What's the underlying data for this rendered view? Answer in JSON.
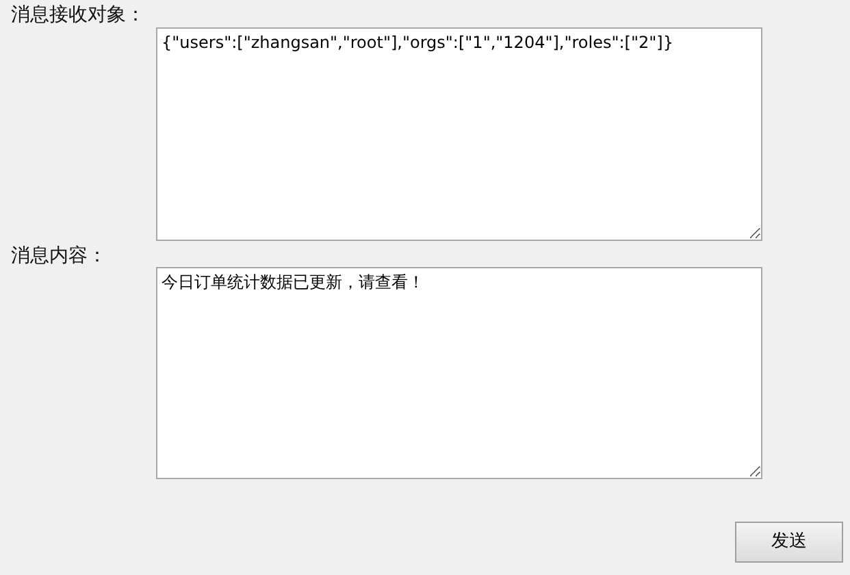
{
  "fields": [
    {
      "label": "消息接收对象：",
      "value": "{\"users\":[\"zhangsan\",\"root\"],\"orgs\":[\"1\",\"1204\"],\"roles\":[\"2\"]}"
    },
    {
      "label": "消息内容：",
      "value": "今日订单统计数据已更新，请查看！"
    }
  ],
  "button": "发送"
}
